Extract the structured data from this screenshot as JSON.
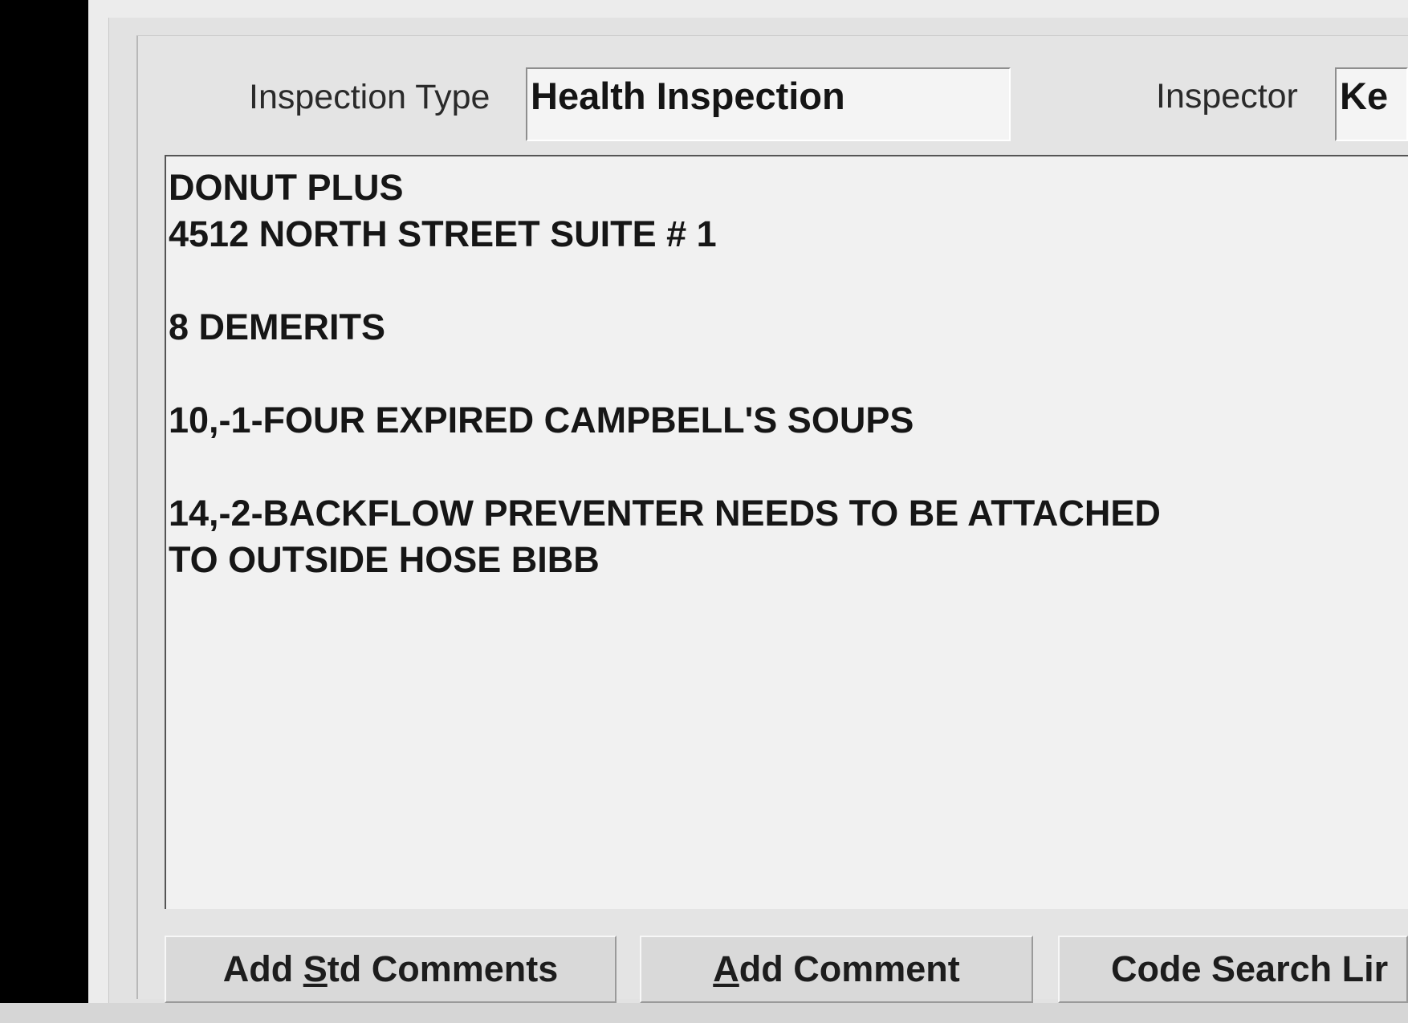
{
  "header": {
    "inspection_type_label": "Inspection Type",
    "inspection_type_value": "Health Inspection",
    "inspector_label": "Inspector",
    "inspector_value": "Ke"
  },
  "comments": {
    "text": "DONUT PLUS\n4512 NORTH STREET SUITE # 1\n\n8 DEMERITS\n\n10,-1-FOUR EXPIRED CAMPBELL'S SOUPS\n\n14,-2-BACKFLOW PREVENTER NEEDS TO BE ATTACHED\nTO OUTSIDE HOSE BIBB"
  },
  "buttons": {
    "add_std_comments": {
      "before": "Add ",
      "mnemonic": "S",
      "after": "td Comments"
    },
    "add_comment": {
      "before": "",
      "mnemonic": "A",
      "after": "dd Comment"
    },
    "code_search": {
      "label": "Code Search Lir"
    }
  }
}
